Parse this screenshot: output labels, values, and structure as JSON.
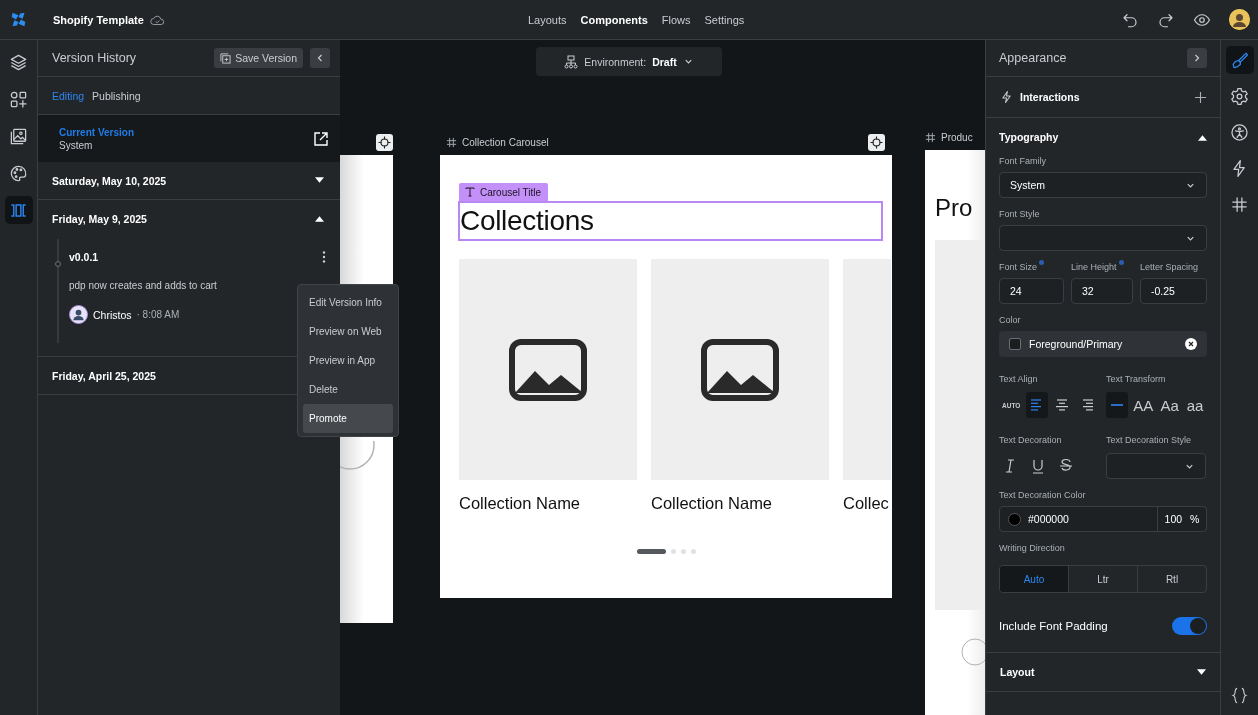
{
  "app": {
    "title": "Shopify Template"
  },
  "nav": [
    {
      "label": "Layouts",
      "selected": false
    },
    {
      "label": "Components",
      "selected": true
    },
    {
      "label": "Flows",
      "selected": false
    },
    {
      "label": "Settings",
      "selected": false
    }
  ],
  "toolbar": [
    {
      "kind": "undo"
    },
    {
      "kind": "redo"
    },
    {
      "kind": "preview"
    }
  ],
  "left_rail": [
    {
      "kind": "layers",
      "selected": false
    },
    {
      "kind": "components",
      "selected": false
    },
    {
      "kind": "images",
      "selected": false
    },
    {
      "kind": "palette",
      "selected": false
    },
    {
      "kind": "versions",
      "selected": true
    }
  ],
  "version_panel": {
    "title": "Version History",
    "save_button": "Save Version",
    "tabs": [
      {
        "label": "Editing",
        "selected": true
      },
      {
        "label": "Publishing",
        "selected": false
      }
    ],
    "current": {
      "label": "Current Version",
      "name": "System"
    },
    "groups": [
      {
        "date": "Saturday, May 10, 2025",
        "expanded": false
      },
      {
        "date": "Friday, May 9, 2025",
        "expanded": true,
        "versions": [
          {
            "name": "v0.0.1",
            "description": "pdp now creates and adds to cart",
            "author": "Christos",
            "time": "· 8:08 AM"
          }
        ]
      },
      {
        "date": "Friday, April 25, 2025"
      }
    ]
  },
  "menu": [
    {
      "label": "Edit Version Info",
      "highlighted": false
    },
    {
      "label": "Preview on Web",
      "highlighted": false
    },
    {
      "label": "Preview in App",
      "highlighted": false
    },
    {
      "label": "Delete",
      "highlighted": false
    },
    {
      "label": "Promote",
      "highlighted": true
    }
  ],
  "canvas": {
    "environment": {
      "label": "Environment:",
      "value": "Draft"
    },
    "carousel": {
      "label": "Collection Carousel",
      "selection_tag": "Carousel Title",
      "heading": "Collections",
      "cards": [
        "Collection Name",
        "Collection Name",
        "Collec"
      ],
      "pages": [
        {
          "selected": true
        },
        {
          "selected": false
        },
        {
          "selected": false
        },
        {
          "selected": false
        }
      ]
    },
    "next_frame": {
      "label": "Produc",
      "heading": "Pro"
    }
  },
  "properties": {
    "title": "Appearance",
    "interactions": "Interactions",
    "typography": {
      "title": "Typography",
      "expanded": true,
      "font_family": {
        "label": "Font Family",
        "value": "System"
      },
      "font_style": {
        "label": "Font Style"
      },
      "metrics": [
        {
          "label": "Font Size",
          "value": "24",
          "modified": true
        },
        {
          "label": "Line Height",
          "value": "32",
          "modified": true
        },
        {
          "label": "Letter Spacing",
          "value": "-0.25",
          "modified": false
        }
      ],
      "color": {
        "label": "Color",
        "value": "Foreground/Primary"
      },
      "text_align": {
        "label": "Text Align",
        "options": [
          {
            "kind": "auto",
            "label": "AUTO",
            "selected": false
          },
          {
            "kind": "left",
            "selected": true
          },
          {
            "kind": "center",
            "selected": false
          },
          {
            "kind": "right",
            "selected": false
          }
        ]
      },
      "text_transform": {
        "label": "Text Transform",
        "options": [
          {
            "kind": "none",
            "selected": true
          },
          {
            "kind": "text",
            "label": "AA",
            "selected": false
          },
          {
            "kind": "text",
            "label": "Aa",
            "selected": false
          },
          {
            "kind": "text",
            "label": "aa",
            "selected": false
          }
        ]
      },
      "text_decoration": {
        "label": "Text Decoration",
        "options": [
          {
            "kind": "italic",
            "selected": false
          },
          {
            "kind": "underline",
            "selected": false
          },
          {
            "kind": "strike",
            "selected": false
          }
        ]
      },
      "decoration_style": {
        "label": "Text Decoration Style"
      },
      "decoration_color": {
        "label": "Text Decoration Color",
        "value": "#000000",
        "opacity": "100",
        "unit": "%"
      },
      "writing_direction": {
        "label": "Writing Direction",
        "options": [
          {
            "label": "Auto",
            "selected": true
          },
          {
            "label": "Ltr",
            "selected": false
          },
          {
            "label": "Rtl",
            "selected": false
          }
        ]
      },
      "font_padding": {
        "label": "Include Font Padding",
        "on": true
      }
    },
    "layout": {
      "title": "Layout",
      "expanded": false
    }
  },
  "right_rail": [
    {
      "kind": "style",
      "selected": true
    },
    {
      "kind": "settings",
      "selected": false
    },
    {
      "kind": "accessibility",
      "selected": false
    },
    {
      "kind": "interactions",
      "selected": false
    },
    {
      "kind": "grid",
      "selected": false
    }
  ],
  "right_rail_bottom": {
    "kind": "code"
  }
}
